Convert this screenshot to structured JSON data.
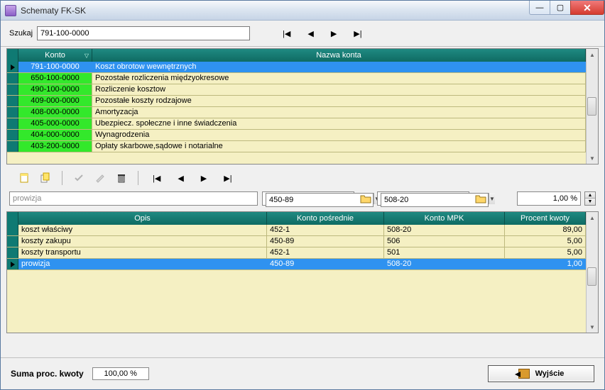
{
  "window": {
    "title": "Schematy FK-SK"
  },
  "search": {
    "label": "Szukaj",
    "value": "791-100-0000"
  },
  "nav_icons": {
    "first": "|◀",
    "prev": "◀",
    "next": "▶",
    "last": "▶|"
  },
  "top_grid": {
    "headers": {
      "account": "Konto",
      "name": "Nazwa konta"
    },
    "rows": [
      {
        "account": "791-100-0000",
        "name": "Koszt obrotow wewnętrznych",
        "selected": true
      },
      {
        "account": "650-100-0000",
        "name": "Pozostałe rozliczenia międzyokresowe",
        "selected": false
      },
      {
        "account": "490-100-0000",
        "name": "Rozliczenie kosztow",
        "selected": false
      },
      {
        "account": "409-000-0000",
        "name": "Pozostałe koszty rodzajowe",
        "selected": false
      },
      {
        "account": "408-000-0000",
        "name": "Amortyzacja",
        "selected": false
      },
      {
        "account": "405-000-0000",
        "name": "Ubezpiecz. społeczne i inne świadczenia",
        "selected": false
      },
      {
        "account": "404-000-0000",
        "name": "Wynagrodzenia",
        "selected": false
      },
      {
        "account": "403-200-0000",
        "name": "Opłaty skarbowe,sądowe i notarialne",
        "selected": false
      }
    ]
  },
  "edit_row": {
    "desc_value": "prowizja",
    "acct1_value": "450-89",
    "acct2_value": "508-20",
    "pct_value": "1,00 %"
  },
  "bottom_grid": {
    "headers": {
      "opis": "Opis",
      "kp": "Konto pośrednie",
      "kmpk": "Konto MPK",
      "pk": "Procent kwoty"
    },
    "rows": [
      {
        "opis": "koszt właściwy",
        "kp": "452-1",
        "kmpk": "508-20",
        "pk": "89,00",
        "selected": false
      },
      {
        "opis": "koszty zakupu",
        "kp": "450-89",
        "kmpk": "506",
        "pk": "5,00",
        "selected": false
      },
      {
        "opis": "koszty transportu",
        "kp": "452-1",
        "kmpk": "501",
        "pk": "5,00",
        "selected": false
      },
      {
        "opis": "prowizja",
        "kp": "450-89",
        "kmpk": "508-20",
        "pk": "1,00",
        "selected": true
      }
    ]
  },
  "footer": {
    "label": "Suma proc. kwoty",
    "value": "100,00 %",
    "exit_label": "Wyjście"
  },
  "toolbar_icons": {
    "new": "new-icon",
    "copy": "copy-icon",
    "apply": "check-icon",
    "edit": "pencil-icon",
    "delete": "trash-icon"
  }
}
